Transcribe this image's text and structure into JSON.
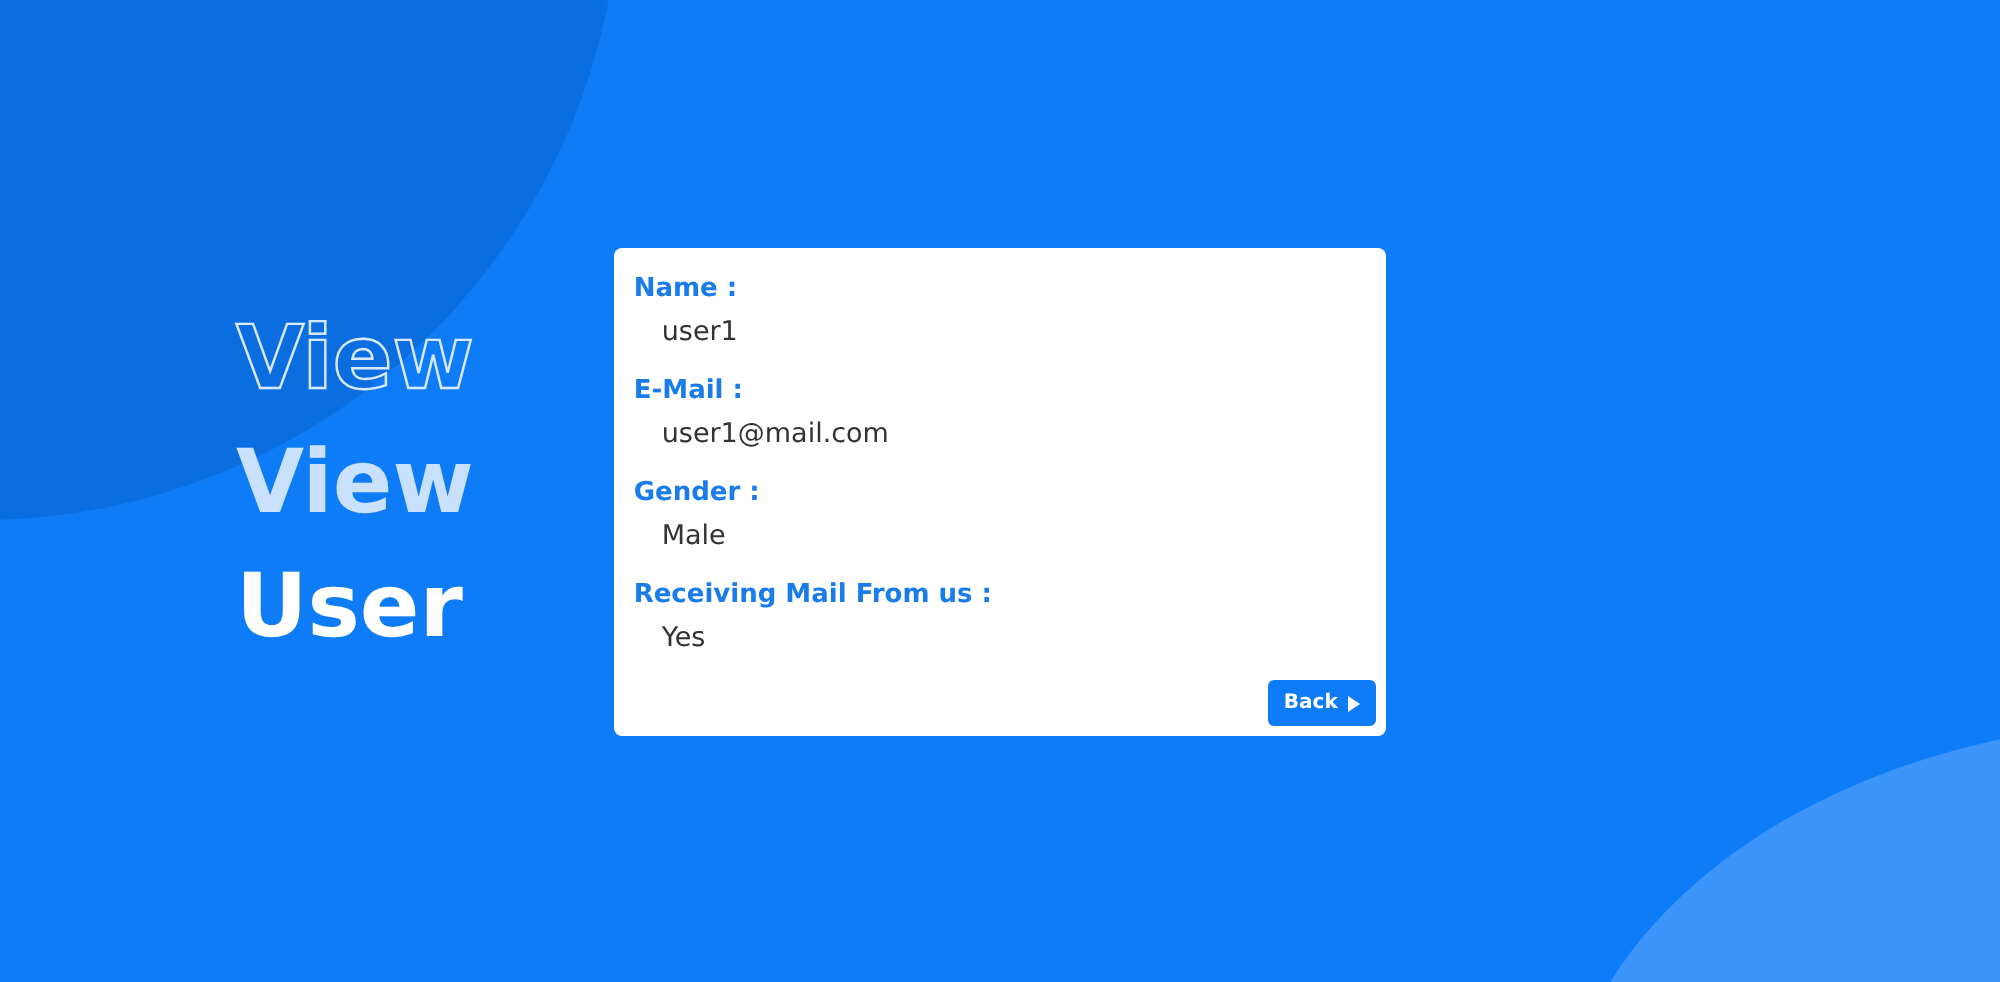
{
  "heading": [
    {
      "text": "View",
      "kind": "outline"
    },
    {
      "text": "View",
      "kind": "faded"
    },
    {
      "text": "User",
      "kind": "solid"
    }
  ],
  "fields": [
    {
      "label": "Name :",
      "value": "user1"
    },
    {
      "label": "E-Mail :",
      "value": "user1@mail.com"
    },
    {
      "label": "Gender :",
      "value": "Male"
    },
    {
      "label": "Receiving Mail From us :",
      "value": "Yes"
    }
  ],
  "back_button": {
    "label": "Back"
  }
}
